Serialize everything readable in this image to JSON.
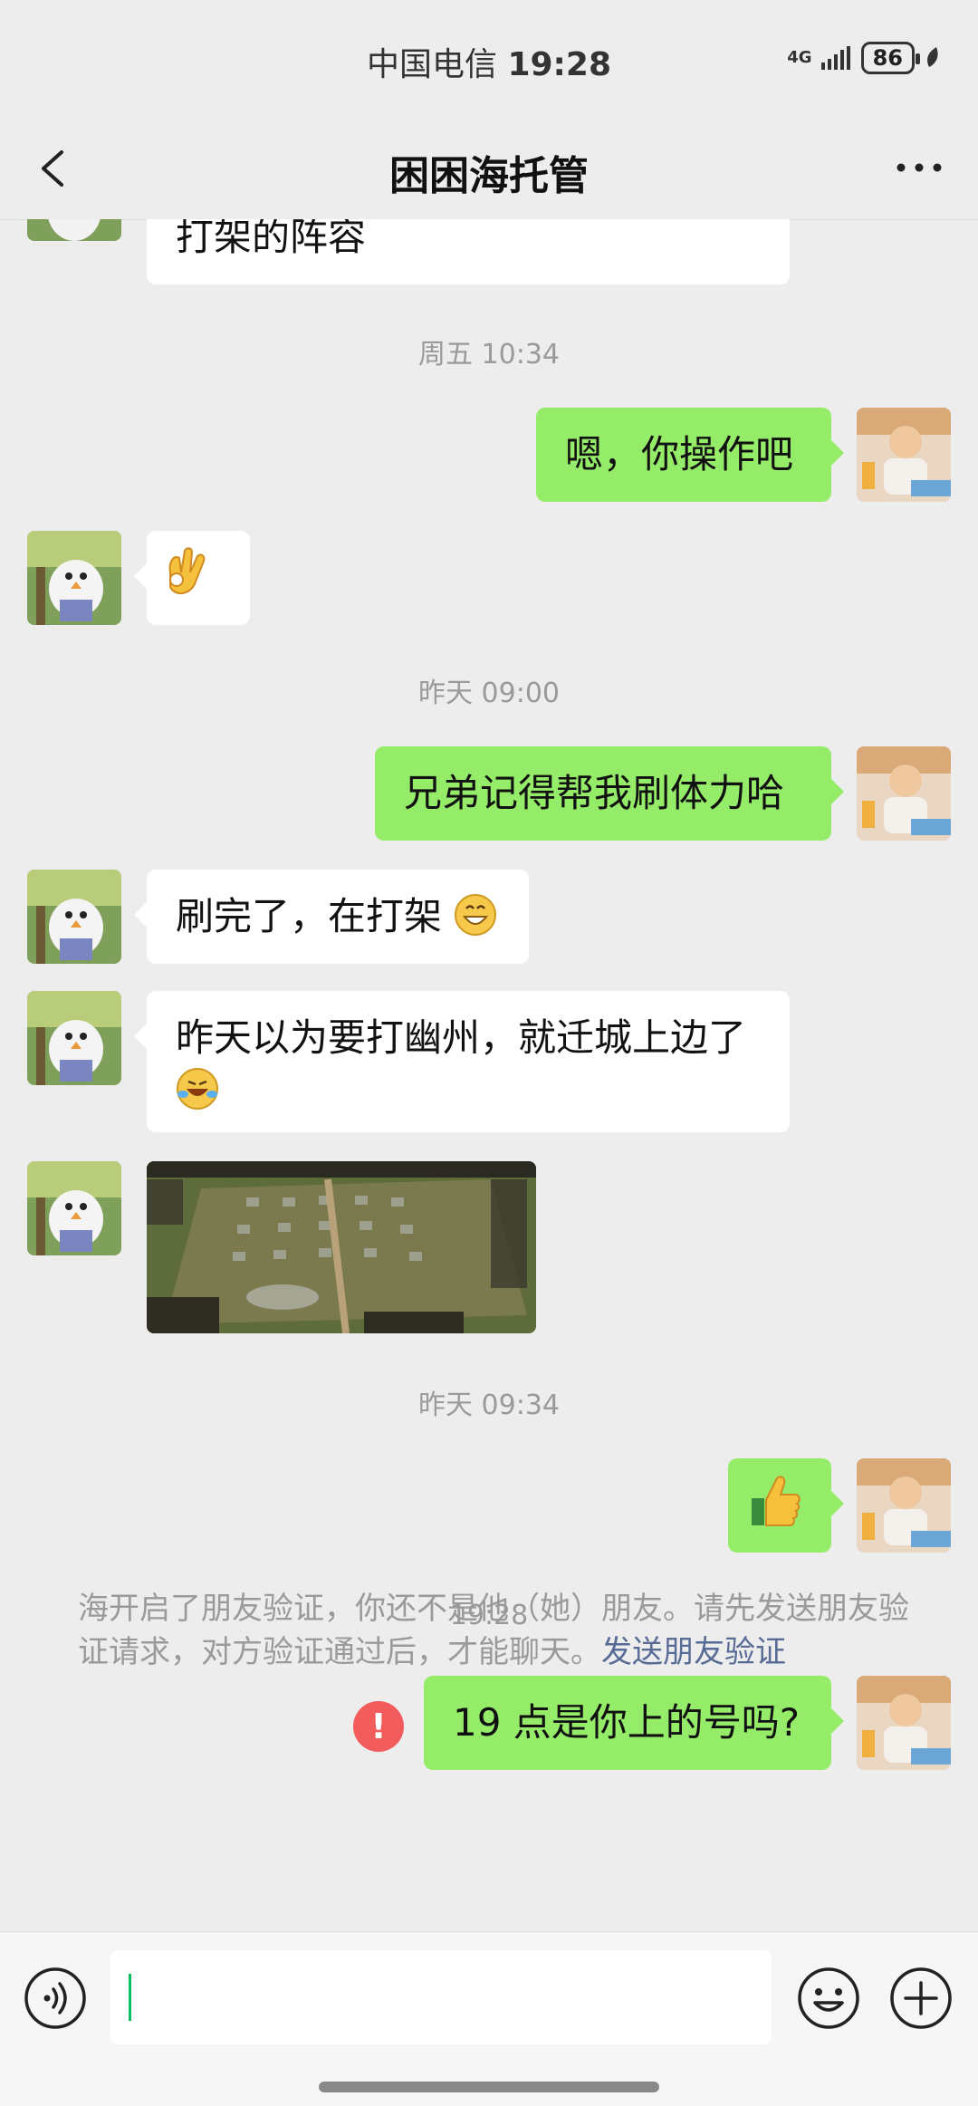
{
  "status": {
    "carrier": "中国电信",
    "time": "19:28",
    "network": "4G",
    "battery": "86"
  },
  "header": {
    "title": "困困海托管"
  },
  "messages": {
    "m1_text": "打架的阵容",
    "ts1": "周五 10:34",
    "m2_text": "嗯，你操作吧",
    "ts2": "昨天 09:00",
    "m4_text": "兄弟记得帮我刷体力哈",
    "m5_text": "刷完了，在打架",
    "m6_text": "昨天以为要打幽州，就迁城上边了",
    "ts3": "昨天 09:34",
    "ts4": "19:28",
    "m9_text": "19 点是你上的号吗?",
    "m9_error": "!"
  },
  "notice": {
    "text": "海开启了朋友验证，你还不是他（她）朋友。请先发送朋友验证请求，对方验证通过后，才能聊天。",
    "link": "发送朋友验证"
  },
  "input": {
    "value": ""
  },
  "colors": {
    "bubble_self": "#95EC69",
    "bubble_other": "#FFFFFF",
    "background": "#EDEDED",
    "link": "#576B95",
    "error": "#F25C5C"
  },
  "icons": [
    "back-arrow-icon",
    "more-icon",
    "ok-hand-emoji",
    "grinning-emoji",
    "laughing-crying-emoji",
    "thumbs-up-emoji",
    "voice-icon",
    "emoji-face-icon",
    "plus-icon"
  ]
}
